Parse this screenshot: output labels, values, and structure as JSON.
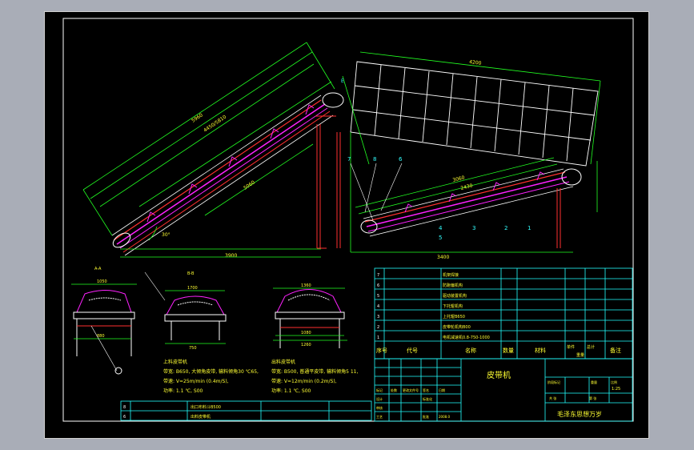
{
  "colors": {
    "background": "#000000",
    "viewport": "#a9adb7",
    "frame_line": "#ffffff",
    "dim_green": "#22ff22",
    "belt_magenta": "#ff22ff",
    "structure_red": "#ff3030",
    "text_yellow": "#ffff33",
    "text_cyan": "#33ffff",
    "table_cyan": "#22ffff"
  },
  "drawing": {
    "dims": {
      "left_length": "5960",
      "left_length2": "4450/5810",
      "left_seg": "5060",
      "left_base": "3900",
      "angle_left": "30°",
      "panel_top": "4200",
      "right_base": "3400",
      "right_len": "3060",
      "right_seg": "2430"
    },
    "callouts": [
      "7",
      "8",
      "6",
      "5",
      "4",
      "3",
      "2",
      "1",
      "E"
    ],
    "small_labels": [
      "A-A",
      "B-B"
    ],
    "section_dims": {
      "s1_top": "1050",
      "s1_w": "880",
      "s2_top": "1700",
      "s2_w": "750",
      "s3_top": "1360",
      "s3_w": "1080",
      "s3_w2": "1260"
    }
  },
  "notes": {
    "left": {
      "title": "上料皮带机",
      "lines": [
        "带宽: B650, 大倾角皮带, 输料倾角30 ℃65,",
        "带速: V=25m/min (0.4m/S),",
        "功率: 1.1 ℃, S00"
      ]
    },
    "right": {
      "title": "出料皮带机",
      "lines": [
        "带宽: B500, 普通平皮带, 输料倾角5 11,",
        "带速: V=12m/min (0.2m/S),",
        "功率: 1.1 ℃, S00"
      ]
    }
  },
  "small_table": {
    "rows": [
      {
        "no": "8",
        "name": "出口布料斗B500"
      },
      {
        "no": "6",
        "name": "出料皮带机"
      }
    ]
  },
  "parts_table": {
    "rows": [
      {
        "no": "7",
        "name": "机架焊接"
      },
      {
        "no": "6",
        "name": "防跑偏机构"
      },
      {
        "no": "5",
        "name": "驱动装置机构"
      },
      {
        "no": "4",
        "name": "下托辊机构"
      },
      {
        "no": "3",
        "name": "上托辊B650"
      },
      {
        "no": "2",
        "name": "皮带轮机构B00"
      },
      {
        "no": "1",
        "name": "电机减速机0.8-750-1000"
      }
    ],
    "header": {
      "no": "序号",
      "code": "代号",
      "name": "名称",
      "qty": "数量",
      "material": "材料",
      "single": "单件",
      "total": "总计",
      "weight": "重量",
      "remark": "备注"
    }
  },
  "title_block": {
    "product": "皮带机",
    "company": "毛泽东思想万岁",
    "scale": "1:25",
    "labels": {
      "marker": "标记",
      "count": "处数",
      "zone": "分区",
      "change_doc": "更改文件号",
      "sign": "签名",
      "date": "日期",
      "design": "设计",
      "check": "审核",
      "process": "工艺",
      "approve": "批准",
      "std": "标准化",
      "stage": "阶段标记",
      "weight": "重量",
      "scale_label": "比例",
      "sheet": "共  张",
      "sheet2": "第  张",
      "year": "2008.0"
    }
  }
}
